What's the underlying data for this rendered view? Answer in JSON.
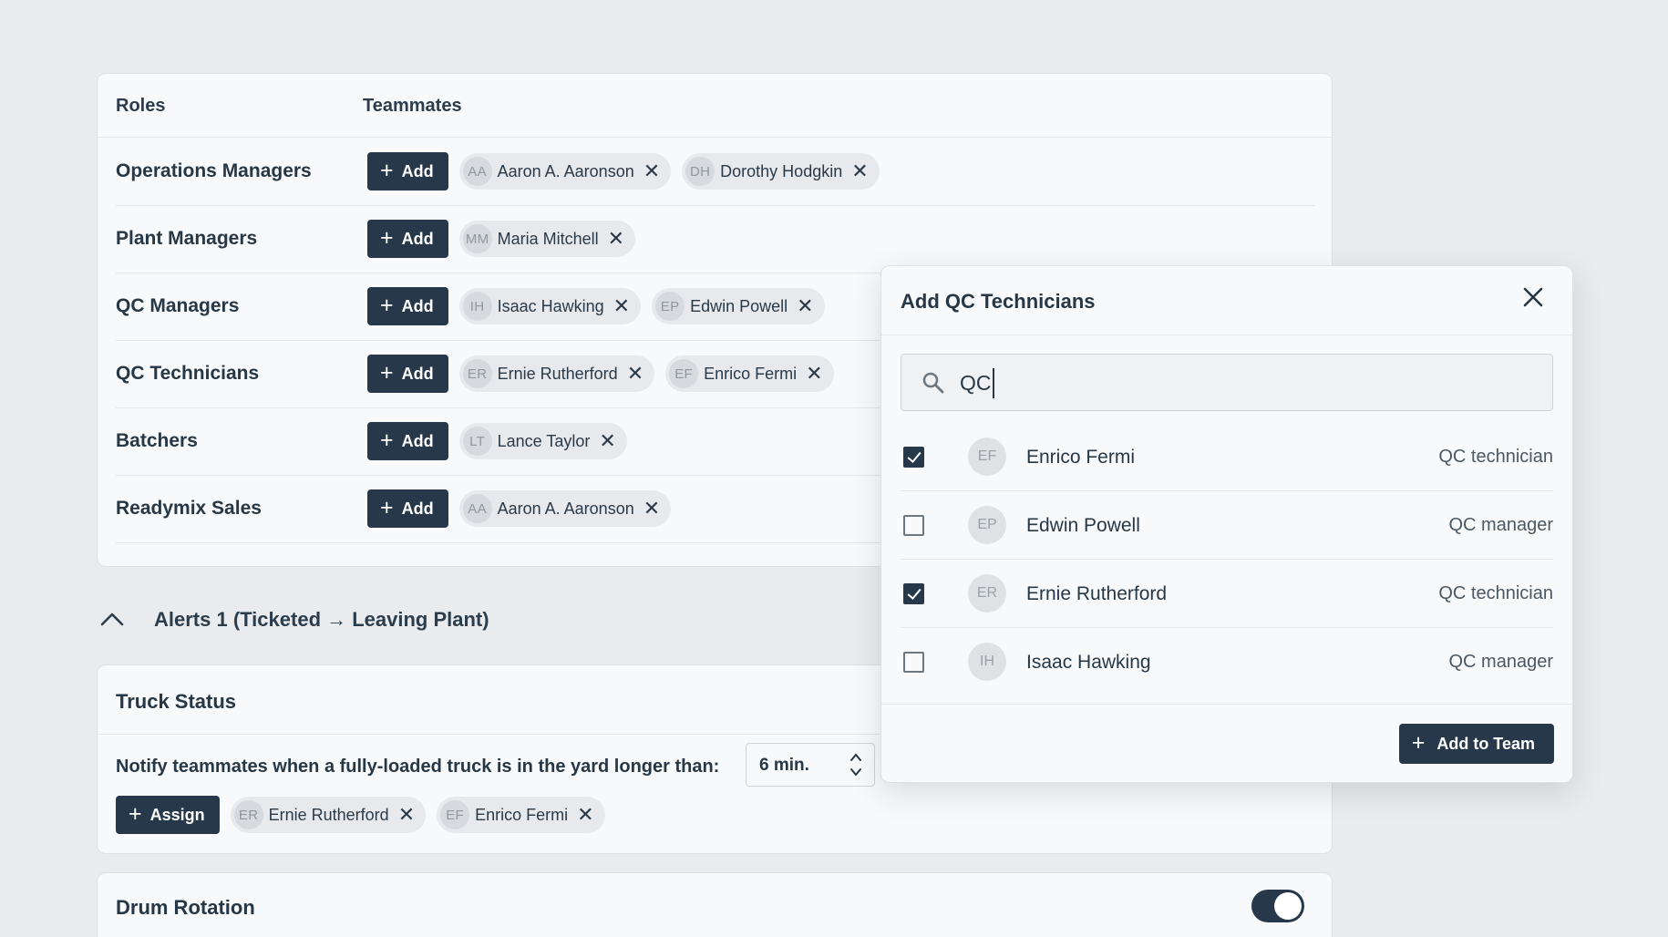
{
  "roles_table": {
    "headers": {
      "roles": "Roles",
      "teammates": "Teammates"
    },
    "add_label": "Add",
    "rows": [
      {
        "role": "Operations Managers",
        "members": [
          {
            "initials": "AA",
            "name": "Aaron A. Aaronson"
          },
          {
            "initials": "DH",
            "name": "Dorothy Hodgkin"
          }
        ]
      },
      {
        "role": "Plant Managers",
        "members": [
          {
            "initials": "MM",
            "name": "Maria Mitchell"
          }
        ]
      },
      {
        "role": "QC Managers",
        "members": [
          {
            "initials": "IH",
            "name": "Isaac Hawking"
          },
          {
            "initials": "EP",
            "name": "Edwin Powell"
          }
        ]
      },
      {
        "role": "QC Technicians",
        "members": [
          {
            "initials": "ER",
            "name": "Ernie Rutherford"
          },
          {
            "initials": "EF",
            "name": "Enrico Fermi"
          }
        ]
      },
      {
        "role": "Batchers",
        "members": [
          {
            "initials": "LT",
            "name": "Lance Taylor"
          }
        ]
      },
      {
        "role": "Readymix Sales",
        "members": [
          {
            "initials": "AA",
            "name": "Aaron A. Aaronson"
          }
        ]
      }
    ]
  },
  "alerts": {
    "title": "Alerts 1 (Ticketed → Leaving Plant)"
  },
  "truck_status": {
    "title": "Truck Status",
    "notify_text": "Notify teammates when a fully-loaded truck is in the yard longer than:",
    "minutes_value": "6 min.",
    "assign_label": "Assign",
    "assigned": [
      {
        "initials": "ER",
        "name": "Ernie Rutherford"
      },
      {
        "initials": "EF",
        "name": "Enrico Fermi"
      }
    ]
  },
  "drum_rotation": {
    "title": "Drum Rotation",
    "enabled": true
  },
  "modal": {
    "title": "Add QC Technicians",
    "search_value": "QC",
    "options": [
      {
        "initials": "EF",
        "name": "Enrico Fermi",
        "role": "QC technician",
        "checked": true
      },
      {
        "initials": "EP",
        "name": "Edwin Powell",
        "role": "QC manager",
        "checked": false
      },
      {
        "initials": "ER",
        "name": "Ernie Rutherford",
        "role": "QC technician",
        "checked": true
      },
      {
        "initials": "IH",
        "name": "Isaac Hawking",
        "role": "QC manager",
        "checked": false
      }
    ],
    "add_button_label": "Add to Team"
  },
  "colors": {
    "primary": "#26384a",
    "background": "#eaebee",
    "card": "#f8f9fa",
    "chip": "#e7e9ec"
  }
}
